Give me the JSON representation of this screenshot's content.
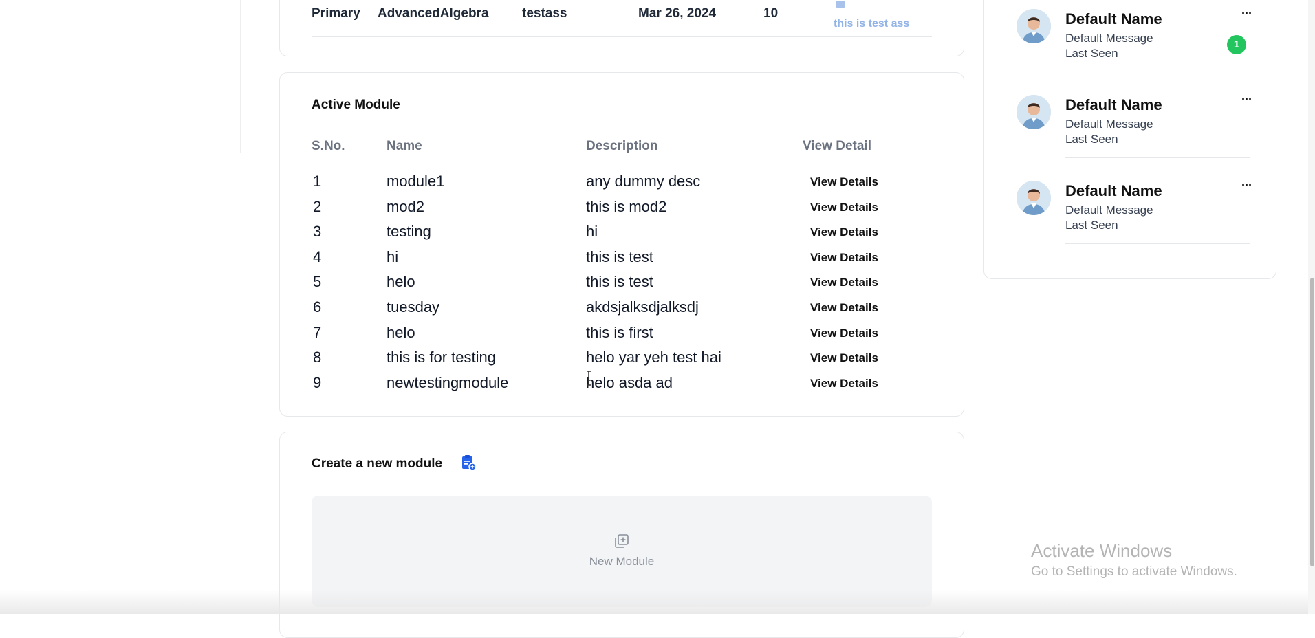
{
  "assignment_row": {
    "level": "Primary",
    "subject": "AdvancedAlgebra",
    "title": "testass",
    "date": "Mar 26, 2024",
    "marks": "10",
    "link_text": "this is test ass"
  },
  "active_module": {
    "title": "Active Module",
    "headers": {
      "sno": "S.No.",
      "name": "Name",
      "description": "Description",
      "view": "View Detail"
    },
    "rows": [
      {
        "sno": "1",
        "name": "module1",
        "description": "any dummy desc",
        "action": "View Details"
      },
      {
        "sno": "2",
        "name": "mod2",
        "description": "this is mod2",
        "action": "View Details"
      },
      {
        "sno": "3",
        "name": "testing",
        "description": "hi",
        "action": "View Details"
      },
      {
        "sno": "4",
        "name": "hi",
        "description": "this is test",
        "action": "View Details"
      },
      {
        "sno": "5",
        "name": "helo",
        "description": "this is test",
        "action": "View Details"
      },
      {
        "sno": "6",
        "name": "tuesday",
        "description": "akdsjalksdjalksdj",
        "action": "View Details"
      },
      {
        "sno": "7",
        "name": "helo",
        "description": "this is first",
        "action": "View Details"
      },
      {
        "sno": "8",
        "name": "this is for testing",
        "description": "helo yar yeh test hai",
        "action": "View Details"
      },
      {
        "sno": "9",
        "name": "newtestingmodule",
        "description": "helo asda ad",
        "action": "View Details"
      }
    ]
  },
  "create_module": {
    "title": "Create a new module",
    "icon": "clipboard-add-icon",
    "button_label": "New Module",
    "button_icon": "add-square-icon"
  },
  "chats": [
    {
      "name": "Default Name",
      "message": "Default Message",
      "last_seen": "Last Seen",
      "unread": "1"
    },
    {
      "name": "Default Name",
      "message": "Default Message",
      "last_seen": "Last Seen",
      "unread": ""
    },
    {
      "name": "Default Name",
      "message": "Default Message",
      "last_seen": "Last Seen",
      "unread": ""
    }
  ],
  "more_menu_label": "···",
  "watermark": {
    "title": "Activate Windows",
    "subtitle": "Go to Settings to activate Windows."
  },
  "colors": {
    "accent_blue": "#2563eb",
    "link_blue": "#93b4e6",
    "unread_green": "#22c55e"
  }
}
